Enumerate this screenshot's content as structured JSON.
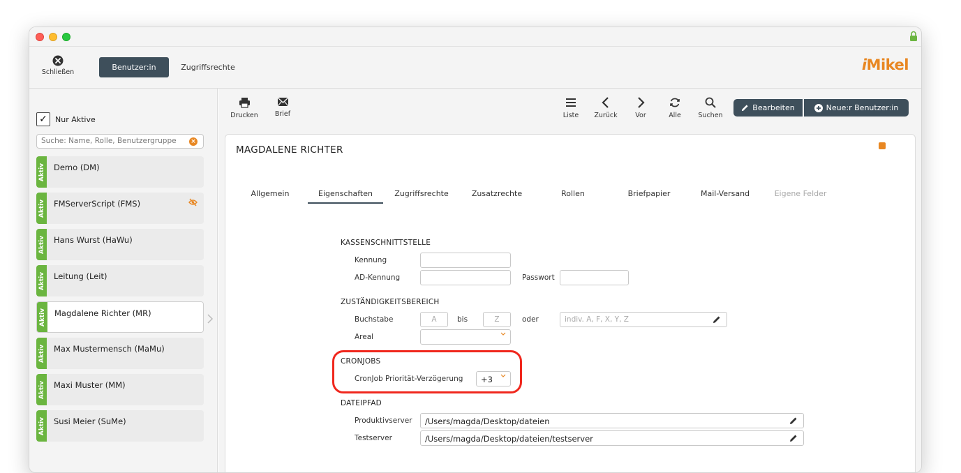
{
  "toolbar": {
    "close_label": "Schließen",
    "segment_active": "Benutzer:in",
    "segment_inactive": "Zugriffsrechte",
    "logo_i": "i",
    "logo_rest": "Mikel"
  },
  "sidebar": {
    "filter_check": "✓",
    "filter_label": "Nur Aktive",
    "search_placeholder": "Suche: Name, Rolle, Benutzergruppe",
    "badge": "Aktiv",
    "items": [
      {
        "name": "Demo (DM)"
      },
      {
        "name": "FMServerScript (FMS)"
      },
      {
        "name": "Hans Wurst (HaWu)"
      },
      {
        "name": "Leitung (Leit)"
      },
      {
        "name": "Magdalene Richter (MR)"
      },
      {
        "name": "Max Mustermensch (MaMu)"
      },
      {
        "name": "Maxi Muster (MM)"
      },
      {
        "name": "Susi Meier (SuMe)"
      }
    ]
  },
  "main_toolbar": {
    "print": "Drucken",
    "letter": "Brief",
    "list": "Liste",
    "back": "Zurück",
    "forward": "Vor",
    "all": "Alle",
    "search": "Suchen",
    "edit": "Bearbeiten",
    "new_user": "Neue:r Benutzer:in"
  },
  "record": {
    "title": "MAGDALENE RICHTER",
    "tabs": [
      "Allgemein",
      "Eigenschaften",
      "Zugriffsrechte",
      "Zusatzrechte",
      "Rollen",
      "Briefpapier",
      "Mail-Versand",
      "Eigene Felder"
    ]
  },
  "form": {
    "kasse": {
      "heading": "KASSENSCHNITTSTELLE",
      "kennung_label": "Kennung",
      "kennung_value": "",
      "ad_label": "AD-Kennung",
      "ad_value": "",
      "passwort_label": "Passwort",
      "passwort_value": ""
    },
    "zustaendigkeit": {
      "heading": "ZUSTÄNDIGKEITSBEREICH",
      "buchstabe_label": "Buchstabe",
      "from_placeholder": "A",
      "bis_label": "bis",
      "to_placeholder": "Z",
      "oder_label": "oder",
      "individual_placeholder": "indiv. A, F, X, Y, Z",
      "areal_label": "Areal",
      "areal_value": ""
    },
    "cronjobs": {
      "heading": "CRONJOBS",
      "delay_label": "CronJob Priorität-Verzögerung",
      "delay_value": "+3"
    },
    "dateipfad": {
      "heading": "DATEIPFAD",
      "prod_label": "Produktivserver",
      "prod_value": "/Users/magda/Desktop/dateien",
      "test_label": "Testserver",
      "test_value": "/Users/magda/Desktop/dateien/testserver"
    }
  },
  "colors": {
    "accent": "#3e4f5b",
    "brand": "#e88722",
    "active_badge": "#6bb540",
    "highlight": "#f0271d"
  }
}
